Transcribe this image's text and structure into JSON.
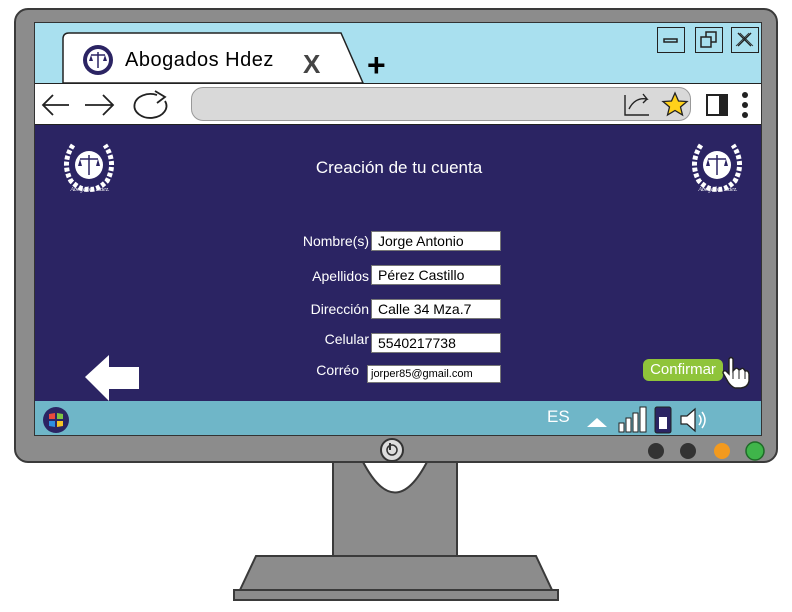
{
  "browser": {
    "tab_title": "Abogados  Hdez",
    "tab_close": "X",
    "new_tab": "+"
  },
  "page": {
    "logo_caption": "Abogados Hdez.",
    "heading": "Creación de tu cuenta",
    "form": {
      "fields": [
        {
          "label": "Nombre(s)",
          "value": "Jorge Antonio"
        },
        {
          "label": "Apellidos",
          "value": "Pérez Castillo"
        },
        {
          "label": "Dirección",
          "value": "Calle 34 Mza.7"
        },
        {
          "label": "Celular",
          "value": "5540217738"
        },
        {
          "label": "Corréo",
          "value": "jorper85@gmail.com"
        }
      ]
    },
    "confirm_label": "Confirmar"
  },
  "taskbar": {
    "language": "ES"
  },
  "colors": {
    "tab_bar": "#a9e0ef",
    "page_background": "#2b2463",
    "confirm_button": "#8fc43a",
    "taskbar": "#6fb6c8",
    "monitor_frame": "#8c8c8c",
    "indicator_orange": "#f39a1e",
    "indicator_green": "#3fb54a"
  },
  "icons": [
    "back-arrow-icon",
    "forward-arrow-icon",
    "reload-icon",
    "share-icon",
    "star-icon",
    "sidebar-icon",
    "menu-dots-icon",
    "minimize-icon",
    "restore-icon",
    "close-icon",
    "back-page-arrow-icon",
    "hand-cursor-icon",
    "start-menu-icon",
    "up-caret-icon",
    "signal-icon",
    "battery-icon",
    "volume-icon",
    "power-icon"
  ]
}
